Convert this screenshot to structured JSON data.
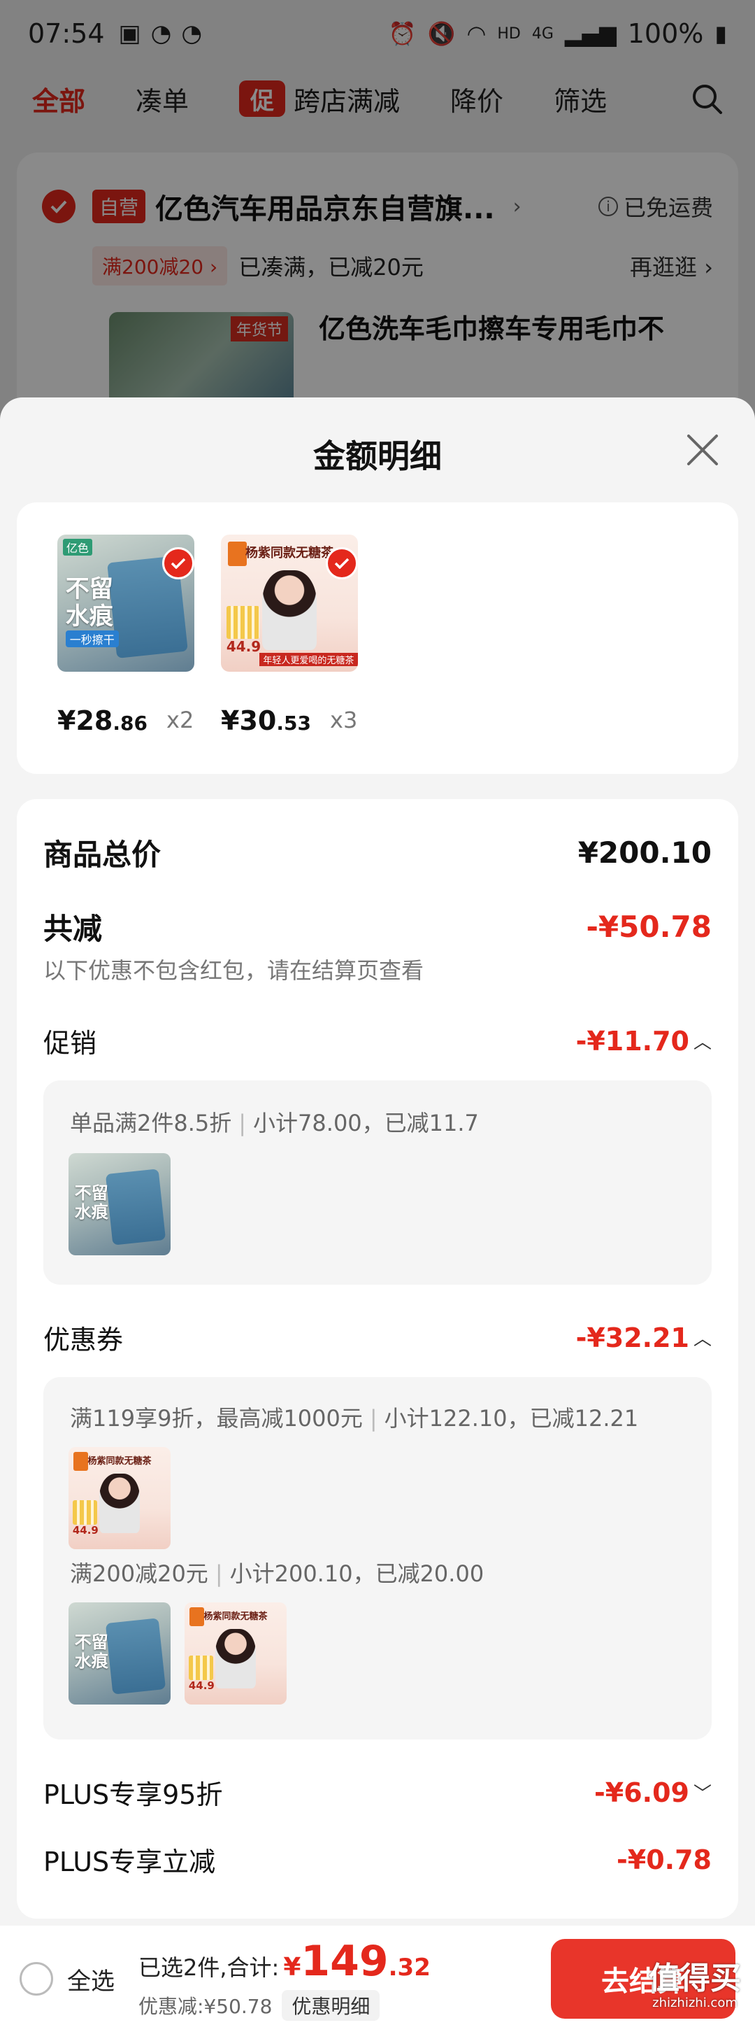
{
  "status_bar": {
    "time": "07:54",
    "battery": "100%",
    "network_label": "HD",
    "net_type": "4G"
  },
  "filter_bar": {
    "tabs": [
      {
        "label": "全部"
      },
      {
        "label": "凑单"
      },
      {
        "label": "跨店满减",
        "badge": "促"
      },
      {
        "label": "降价"
      },
      {
        "label": "筛选"
      }
    ]
  },
  "store": {
    "badge": "自营",
    "name": "亿色汽车用品京东自营旗...",
    "free_shipping": "已免运费",
    "promo_tag": "满200减20",
    "promo_text": "已凑满，已减20元",
    "go_more": "再逛逛",
    "product_title": "亿色洗车毛巾擦车专用毛巾不",
    "product_tag": "年货节"
  },
  "sheet": {
    "title": "金额明细",
    "items": [
      {
        "price_int": "¥28",
        "price_dec": ".86",
        "qty": "x2"
      },
      {
        "price_int": "¥30",
        "price_dec": ".53",
        "qty": "x3"
      }
    ],
    "subtotal_label": "商品总价",
    "subtotal_value": "¥200.10",
    "discount_label": "共减",
    "discount_value": "-¥50.78",
    "discount_note": "以下优惠不包含红包，请在结算页查看",
    "promotion": {
      "label": "促销",
      "value": "-¥11.70",
      "lines": [
        {
          "rule": "单品满2件8.5折",
          "detail": "小计78.00，已减11.7"
        }
      ]
    },
    "coupon": {
      "label": "优惠券",
      "value": "-¥32.21",
      "lines": [
        {
          "rule": "满119享9折，最高减1000元",
          "detail": "小计122.10，已减12.21"
        },
        {
          "rule": "满200减20元",
          "detail": "小计200.10，已减20.00"
        }
      ]
    },
    "plus_discount": {
      "label": "PLUS专享95折",
      "value": "-¥6.09"
    },
    "plus_instant": {
      "label": "PLUS专享立减",
      "value": "-¥0.78"
    }
  },
  "product_images": {
    "towel": {
      "brand": "亿色",
      "line1": "不留",
      "line2": "水痕",
      "pill": "一秒擦干"
    },
    "tea": {
      "headline": "杨紫同款无糖茶",
      "price": "44.9",
      "banner": "年轻人更爱喝的无糖茶"
    }
  },
  "bottom_bar": {
    "select_all": "全选",
    "selected_prefix": "已选2件,合计:",
    "currency": "¥",
    "total_int": "149",
    "total_dec": ".32",
    "saving": "优惠减:¥50.78",
    "detail_tag": "优惠明细",
    "checkout": "去结算"
  },
  "watermark": {
    "main": "值得买",
    "sub": "zhizhizhi.com"
  },
  "colors": {
    "accent": "#e4281c",
    "checkout": "#e8352a",
    "overlay": "rgba(0,0,0,0.46)"
  }
}
